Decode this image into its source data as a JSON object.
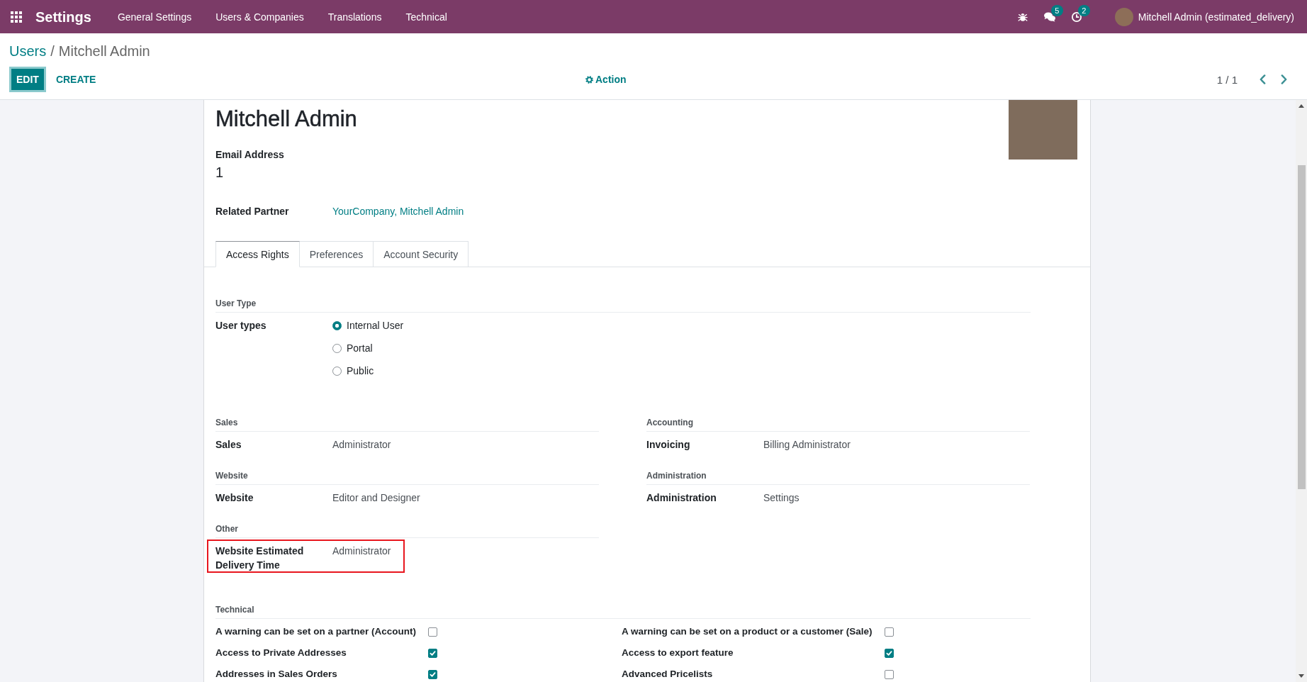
{
  "navbar": {
    "app_name": "Settings",
    "menus": [
      "General Settings",
      "Users & Companies",
      "Translations",
      "Technical"
    ],
    "systray": [
      {
        "kind": "debug"
      },
      {
        "kind": "messages",
        "badge": "5"
      },
      {
        "kind": "activities",
        "badge": "2"
      }
    ],
    "user": "Mitchell Admin (estimated_delivery)"
  },
  "breadcrumb": {
    "items": [
      "Users",
      "Mitchell Admin"
    ],
    "separator": "/"
  },
  "control_panel": {
    "buttons": [
      {
        "label": "EDIT",
        "kind": "primary"
      },
      {
        "label": "CREATE",
        "kind": "secondary"
      }
    ],
    "action": "Action",
    "pager": "1 / 1"
  },
  "form": {
    "name": "Mitchell Admin",
    "email": {
      "label": "Email Address",
      "value": "1"
    },
    "related_partner": {
      "label": "Related Partner",
      "value": "YourCompany, Mitchell Admin"
    },
    "tabs": [
      {
        "label": "Access Rights",
        "selected": true
      },
      {
        "label": "Preferences",
        "selected": false
      },
      {
        "label": "Account Security",
        "selected": false
      }
    ],
    "user_type": {
      "title": "User Type",
      "label": "User types",
      "options": [
        {
          "label": "Internal User",
          "selected": true
        },
        {
          "label": "Portal",
          "selected": false
        },
        {
          "label": "Public",
          "selected": false
        }
      ]
    },
    "groups": [
      {
        "title": "Sales",
        "label": "Sales",
        "value": "Administrator",
        "highlighted": false
      },
      {
        "title": "Accounting",
        "label": "Invoicing",
        "value": "Billing Administrator",
        "highlighted": false
      },
      {
        "title": "Website",
        "label": "Website",
        "value": "Editor and Designer",
        "highlighted": false
      },
      {
        "title": "Administration",
        "label": "Administration",
        "value": "Settings",
        "highlighted": false
      },
      {
        "title": "Other",
        "label": "Website Estimated Delivery Time",
        "value": "Administrator",
        "highlighted": true
      }
    ],
    "technical": {
      "title": "Technical",
      "items": [
        {
          "label": "A warning can be set on a partner (Account)",
          "checked": false
        },
        {
          "label": "A warning can be set on a product or a customer (Sale)",
          "checked": false
        },
        {
          "label": "Access to Private Addresses",
          "checked": true
        },
        {
          "label": "Access to export feature",
          "checked": true
        },
        {
          "label": "Addresses in Sales Orders",
          "checked": true
        },
        {
          "label": "Advanced Pricelists",
          "checked": false
        }
      ]
    }
  }
}
